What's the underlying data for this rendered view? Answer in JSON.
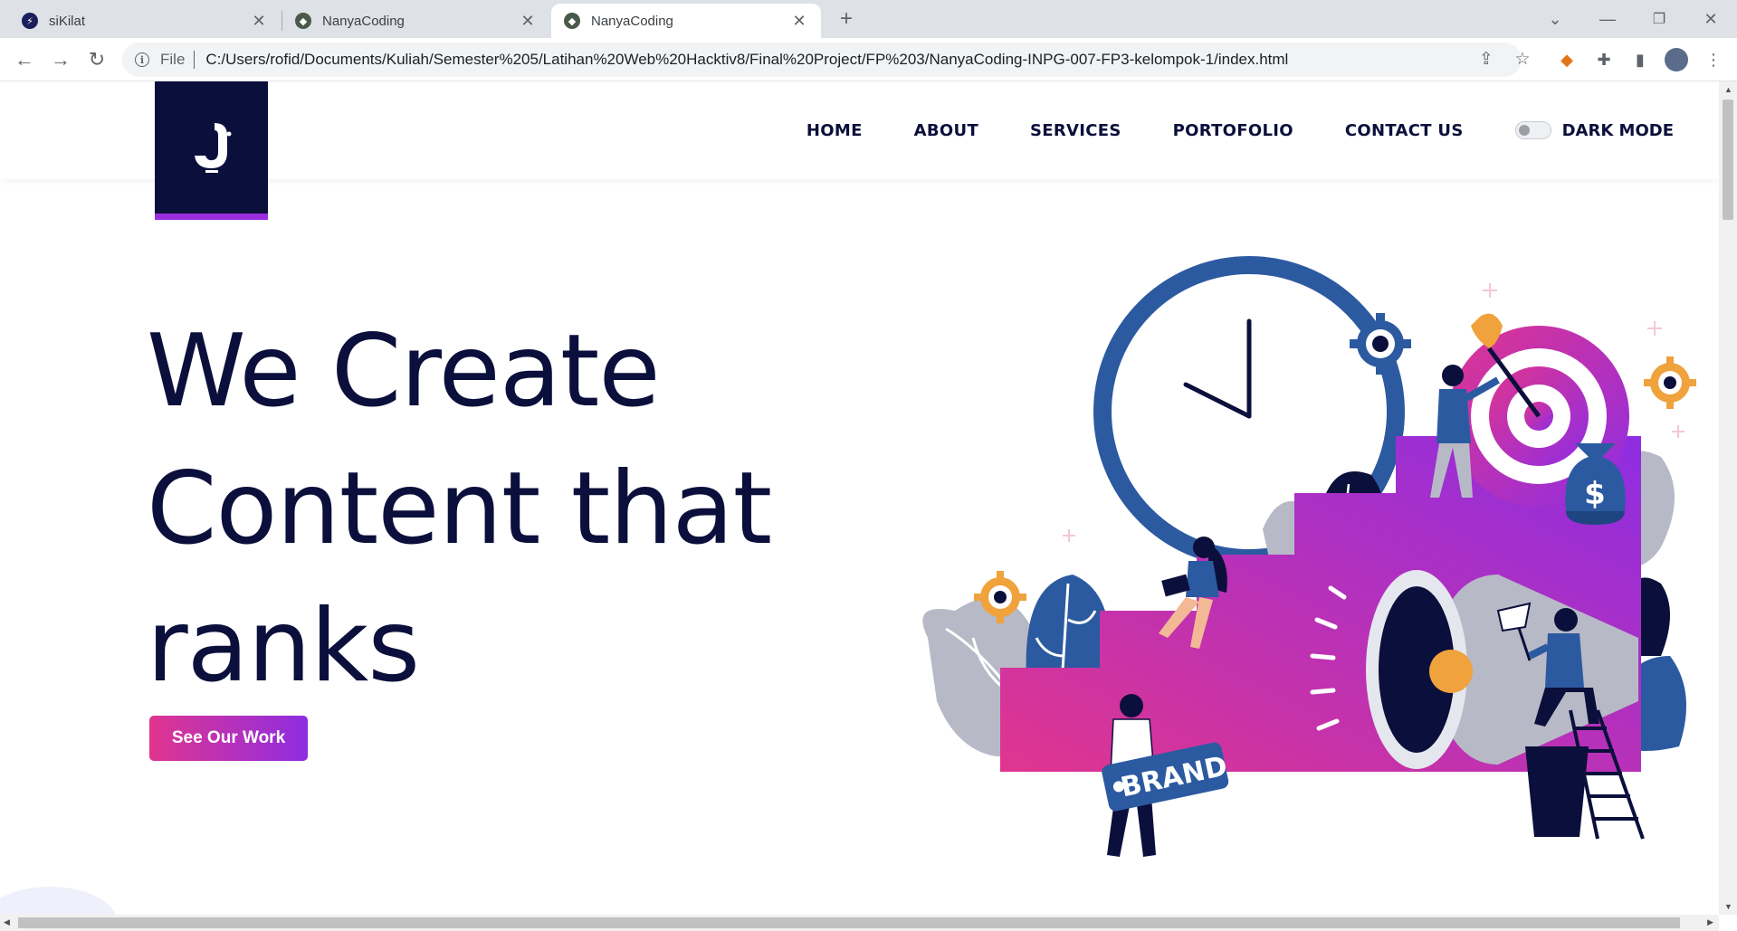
{
  "browser": {
    "tabs": [
      {
        "title": "siKilat",
        "active": false
      },
      {
        "title": "NanyaCoding",
        "active": false
      },
      {
        "title": "NanyaCoding",
        "active": true
      }
    ],
    "new_tab": "+",
    "address": {
      "scheme_label": "File",
      "url": "C:/Users/rofid/Documents/Kuliah/Semester%205/Latihan%20Web%20Hacktiv8/Final%20Project/FP%203/NanyaCoding-INPG-007-FP3-kelompok-1/index.html"
    }
  },
  "site": {
    "nav": [
      "HOME",
      "ABOUT",
      "SERVICES",
      "PORTOFOLIO",
      "CONTACT US"
    ],
    "dark_mode_label": "DARK MODE",
    "hero_title": "We Create Content that ranks",
    "cta_label": "See Our Work",
    "illustration": {
      "brand_tag": "BRAND",
      "money_symbol": "$"
    },
    "colors": {
      "navy": "#0b0f3b",
      "pink": "#e0358f",
      "purple": "#8e2de2",
      "blue": "#2c5aa0",
      "orange": "#f0a23c"
    }
  }
}
